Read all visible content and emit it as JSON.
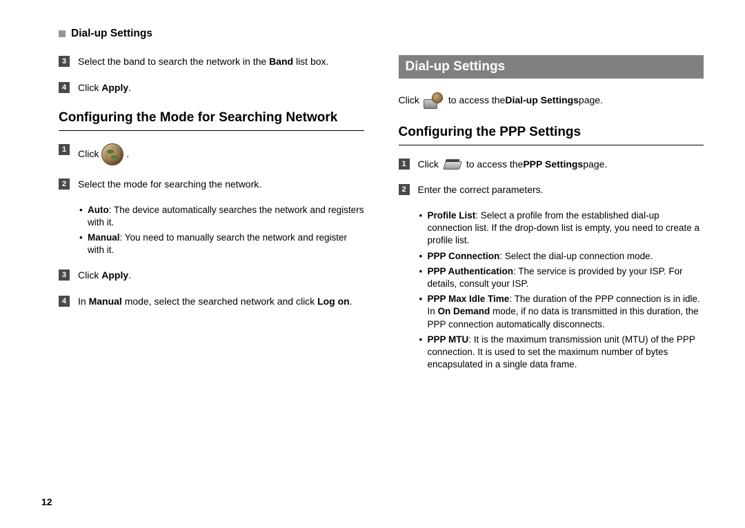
{
  "header": {
    "title": "Dial-up Settings"
  },
  "left": {
    "step3": {
      "pre": "Select the band to search the network in the ",
      "bold": "Band",
      "post": " list box."
    },
    "step4": {
      "pre": "Click ",
      "bold": "Apply",
      "post": "."
    },
    "section": "Configuring the Mode for Searching Network",
    "s1": {
      "pre": "Click",
      "post": " ."
    },
    "s2": "Select the mode for searching the network.",
    "bullets": {
      "auto": {
        "bold": "Auto",
        "text": ": The device automatically searches the network and registers with it."
      },
      "manual": {
        "bold": "Manual",
        "text": ": You need to manually search the network and register with it."
      }
    },
    "s3": {
      "pre": "Click ",
      "bold": "Apply",
      "post": "."
    },
    "s4": {
      "pre": "In ",
      "bold1": "Manual",
      "mid": " mode, select the searched network and click ",
      "bold2": "Log on",
      "post": "."
    }
  },
  "right": {
    "banner": "Dial-up Settings",
    "intro": {
      "pre": "Click ",
      "mid": " to access the ",
      "bold": "Dial-up Settings",
      "post": " page."
    },
    "section": "Configuring the PPP Settings",
    "s1": {
      "pre": "Click",
      "mid": " to access the ",
      "bold": "PPP Settings",
      "post": " page."
    },
    "s2": "Enter the correct parameters.",
    "bullets": {
      "profile": {
        "bold": "Profile List",
        "text": ": Select a profile from the established dial-up connection list. If the drop-down list is empty, you need to create a profile list."
      },
      "conn": {
        "bold": "PPP Connection",
        "text": ": Select the dial-up connection mode."
      },
      "auth": {
        "bold": "PPP Authentication",
        "text": ": The service is provided by your ISP. For details, consult your ISP."
      },
      "idle": {
        "bold": "PPP Max Idle Time",
        "t1": ": The duration of the PPP connection is in idle. In ",
        "bold2": "On Demand",
        "t2": " mode, if no data is transmitted in this duration, the PPP connection automatically disconnects."
      },
      "mtu": {
        "bold": "PPP MTU",
        "text": ": It is the maximum transmission unit (MTU) of the PPP connection. It is used to set the maximum number of bytes encapsulated in a single data frame."
      }
    }
  },
  "page_number": "12"
}
